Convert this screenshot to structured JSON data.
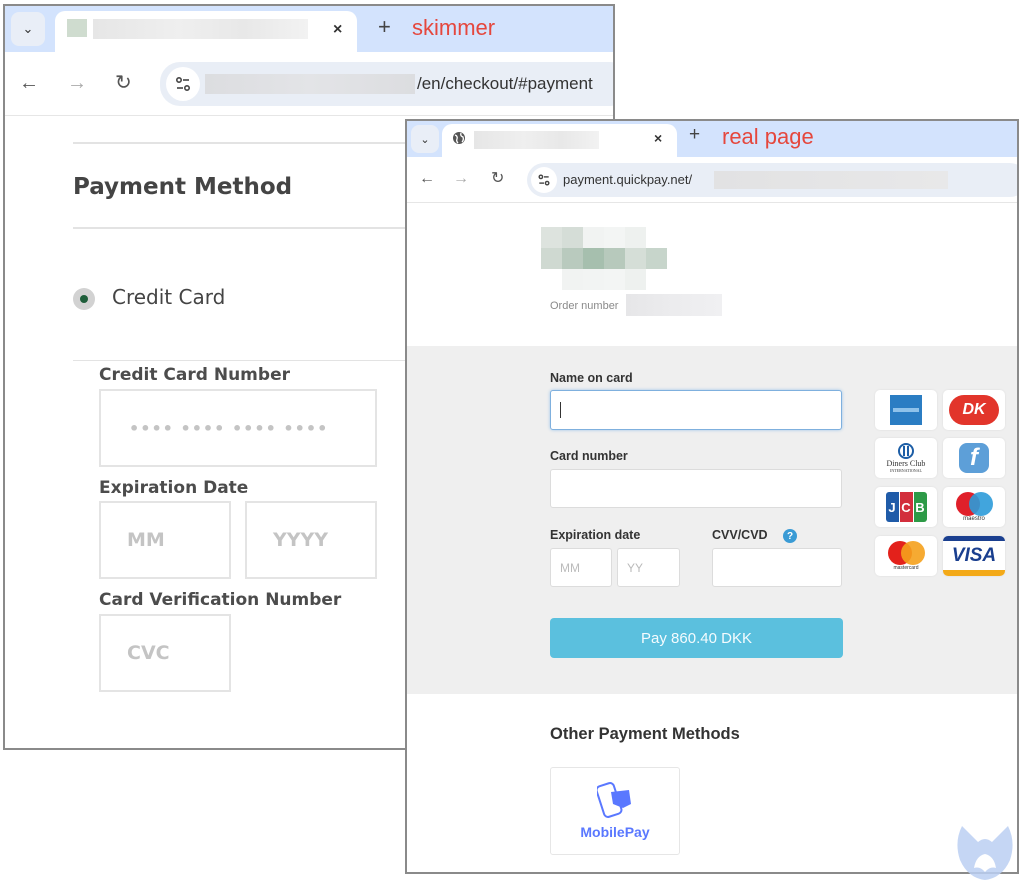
{
  "skimmer_window": {
    "annotation": "skimmer",
    "tab": {
      "title_redacted": true,
      "close_icon": "×",
      "new_tab_icon": "+"
    },
    "toolbar": {
      "back_icon": "←",
      "forward_icon": "→",
      "reload_icon": "↻",
      "url_visible": "/en/checkout/#payment",
      "url_domain_redacted": true
    },
    "content": {
      "title": "Payment Method",
      "radio_option": "Credit Card",
      "radio_selected": true,
      "card_number_label": "Credit Card Number",
      "card_number_placeholder": "•••• •••• •••• ••••",
      "expiration_label": "Expiration Date",
      "month_placeholder": "MM",
      "year_placeholder": "YYYY",
      "cvn_label": "Card Verification Number",
      "cvc_placeholder": "CVC"
    }
  },
  "real_window": {
    "annotation": "real page",
    "tab": {
      "title_redacted": true,
      "close_icon": "×",
      "new_tab_icon": "+"
    },
    "toolbar": {
      "back_icon": "←",
      "forward_icon": "→",
      "reload_icon": "↻",
      "url_visible": "payment.quickpay.net/",
      "url_path_redacted": true
    },
    "header": {
      "logo_redacted": true,
      "order_number_label": "Order number",
      "order_number_redacted": true
    },
    "form": {
      "name_label": "Name on card",
      "name_value": "",
      "card_number_label": "Card number",
      "card_number_value": "",
      "expiration_label": "Expiration date",
      "month_placeholder": "MM",
      "year_placeholder": "YY",
      "cvv_label": "CVV/CVD",
      "cvv_help_icon": "?",
      "pay_button": "Pay 860.40 DKK",
      "pay_color": "#5bc0de"
    },
    "card_brands": [
      "American Express",
      "Dankort",
      "Diners Club International",
      "Forbrugsforeningen",
      "JCB",
      "Maestro",
      "Mastercard",
      "VISA"
    ],
    "card_brand_text": {
      "diners": "Diners Club",
      "diners_sub": "INTERNATIONAL",
      "jcb": "JCB",
      "maestro": "maestro",
      "mastercard": "mastercard",
      "visa": "VISA",
      "dankort": "DK"
    },
    "other_methods": {
      "title": "Other Payment Methods",
      "items": [
        {
          "label": "MobilePay",
          "color": "#5a78ff"
        }
      ]
    }
  },
  "colors": {
    "annotation_red": "#e5473d",
    "tabstrip_blue": "#d3e3fd",
    "skimmer_radio_green": "#1e5e3a"
  },
  "watermark": "malwarebytes-logo"
}
